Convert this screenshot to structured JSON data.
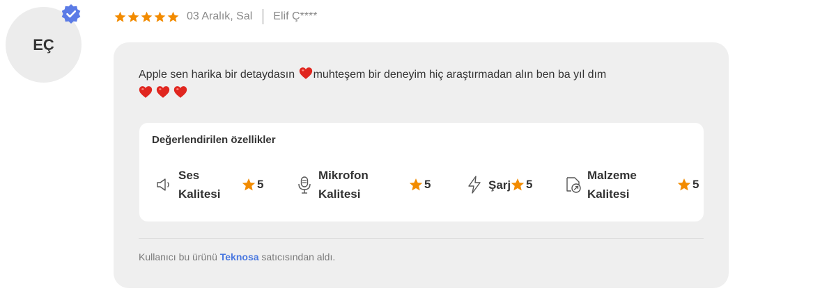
{
  "review": {
    "avatar_initials": "EÇ",
    "rating": 5,
    "date": "03 Aralık, Sal",
    "author": "Elif Ç****",
    "comment_part1": "Apple sen harika bir detaydasın",
    "comment_part2": "muhteşem bir deneyim hiç araştırmadan alın ben ba yıl dım"
  },
  "features": {
    "title": "Değerlendirilen özellikler",
    "items": [
      {
        "icon": "speaker-icon",
        "label_line1": "Ses",
        "label_line2": "Kalitesi",
        "rating": "5"
      },
      {
        "icon": "microphone-icon",
        "label_line1": "Mikrofon",
        "label_line2": "Kalitesi",
        "rating": "5"
      },
      {
        "icon": "lightning-icon",
        "label_line1": "Şarj",
        "label_line2": "",
        "rating": "5"
      },
      {
        "icon": "material-quality-icon",
        "label_line1": "Malzeme",
        "label_line2": "Kalitesi",
        "rating": "5"
      }
    ]
  },
  "seller": {
    "prefix": "Kullanıcı bu ürünü",
    "name": "Teknosa",
    "suffix": "satıcısından aldı."
  },
  "colors": {
    "star": "#f28b00",
    "verified": "#5b7be6",
    "heart": "#e0261f",
    "link": "#4a78e0"
  }
}
